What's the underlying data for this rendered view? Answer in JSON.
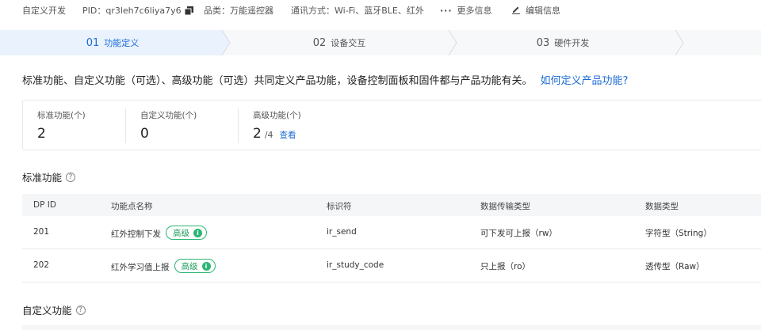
{
  "infobar": {
    "title": "自定义开发",
    "pid_label": "PID：",
    "pid_value": "qr3leh7c6liya7y6",
    "category_label": "品类：",
    "category_value": "万能遥控器",
    "comm_label": "通讯方式：",
    "comm_value": "Wi-Fi、蓝牙BLE、红外",
    "more_label": "更多信息",
    "edit_label": "编辑信息"
  },
  "steps": [
    {
      "num": "01",
      "label": "功能定义"
    },
    {
      "num": "02",
      "label": "设备交互"
    },
    {
      "num": "03",
      "label": "硬件开发"
    }
  ],
  "intro": {
    "text": "标准功能、自定义功能（可选）、高级功能（可选）共同定义产品功能，设备控制面板和固件都与产品功能有关。",
    "link": "如何定义产品功能?"
  },
  "summary": {
    "standard": {
      "title": "标准功能(个)",
      "value": "2"
    },
    "custom": {
      "title": "自定义功能(个)",
      "value": "0"
    },
    "advanced": {
      "title": "高级功能(个)",
      "value": "2",
      "of": "/4",
      "view": "查看"
    }
  },
  "standard_section": {
    "title": "标准功能",
    "columns": [
      "DP ID",
      "功能点名称",
      "标识符",
      "数据传输类型",
      "数据类型"
    ],
    "rows": [
      {
        "id": "201",
        "name": "红外控制下发",
        "badge": "高级",
        "identifier": "ir_send",
        "transfer": "可下发可上报（rw）",
        "dtype": "字符型（String）"
      },
      {
        "id": "202",
        "name": "红外学习值上报",
        "badge": "高级",
        "identifier": "ir_study_code",
        "transfer": "只上报（ro）",
        "dtype": "透传型（Raw）"
      }
    ]
  },
  "custom_section": {
    "title": "自定义功能"
  },
  "colors": {
    "accent": "#1b6bd6",
    "badge_green": "#2bb673",
    "header_bg": "#f5f6f8"
  },
  "icons": {
    "copy": "copy-icon",
    "more": "more-dots-icon",
    "edit": "edit-pencil-icon",
    "help": "help-circle-icon",
    "info": "info-dot-icon"
  }
}
